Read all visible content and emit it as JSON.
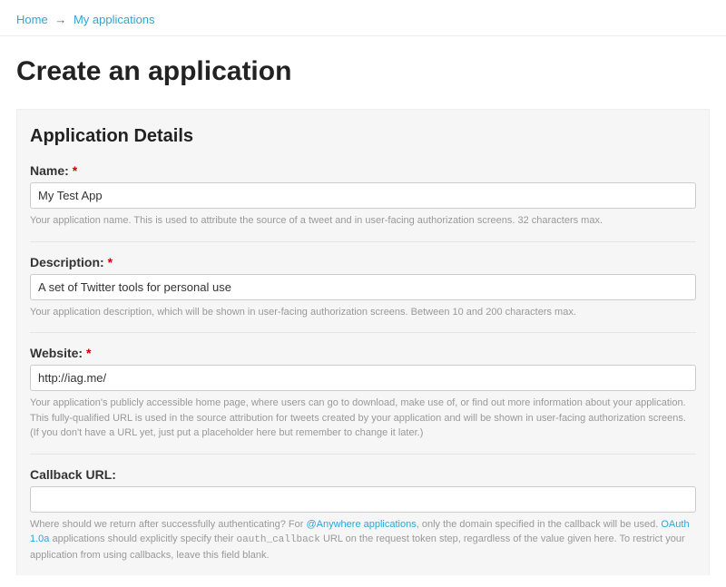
{
  "breadcrumb": {
    "home": "Home",
    "arrow": "→",
    "apps": "My applications"
  },
  "page_title": "Create an application",
  "panel_title": "Application Details",
  "fields": {
    "name": {
      "label": "Name:",
      "value": "My Test App",
      "help": "Your application name. This is used to attribute the source of a tweet and in user-facing authorization screens. 32 characters max."
    },
    "description": {
      "label": "Description:",
      "value": "A set of Twitter tools for personal use",
      "help": "Your application description, which will be shown in user-facing authorization screens. Between 10 and 200 characters max."
    },
    "website": {
      "label": "Website:",
      "value": "http://iag.me/",
      "help1": "Your application's publicly accessible home page, where users can go to download, make use of, or find out more information about your application. This fully-qualified URL is used in the source attribution for tweets created by your application and will be shown in user-facing authorization screens.",
      "help2": "(If you don't have a URL yet, just put a placeholder here but remember to change it later.)"
    },
    "callback": {
      "label": "Callback URL:",
      "value": "",
      "help_pre": "Where should we return after successfully authenticating? For ",
      "help_link1": "@Anywhere applications",
      "help_mid": ", only the domain specified in the callback will be used. ",
      "help_link2": "OAuth 1.0a",
      "help_post1": " applications should explicitly specify their ",
      "help_code": "oauth_callback",
      "help_post2": " URL on the request token step, regardless of the value given here. To restrict your application from using callbacks, leave this field blank."
    }
  },
  "required_mark": "*"
}
